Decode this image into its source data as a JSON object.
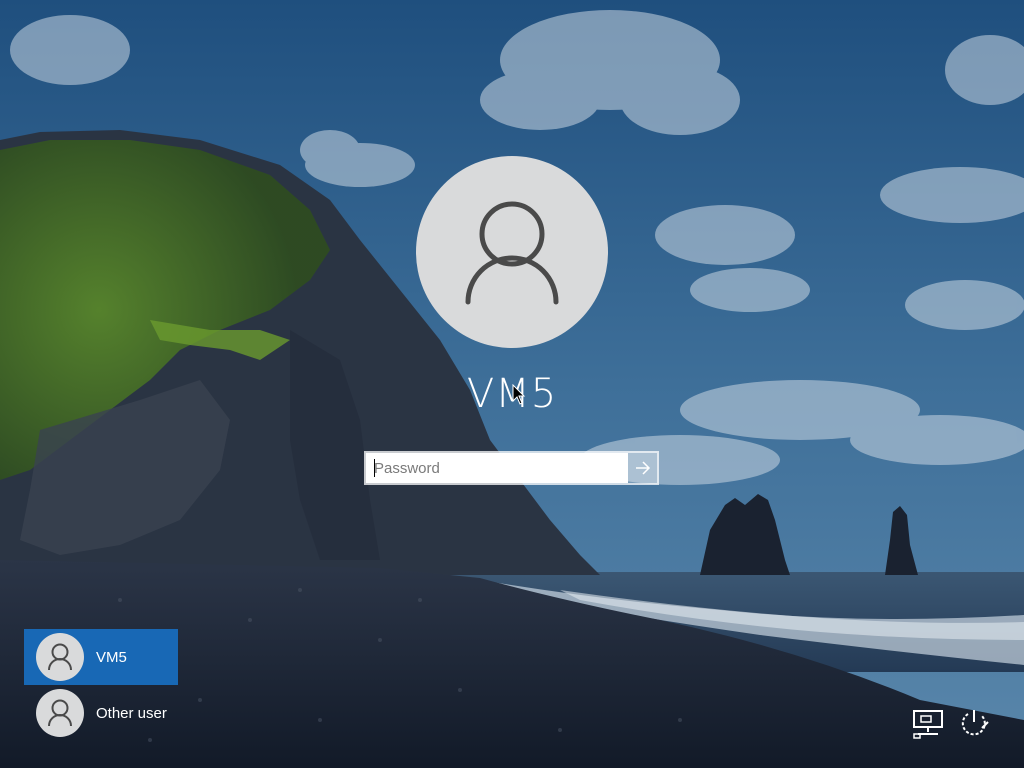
{
  "account": {
    "username": "VM5",
    "password_placeholder": "Password",
    "submit_icon": "arrow-right-icon"
  },
  "user_list": [
    {
      "label": "VM5",
      "icon": "user-icon",
      "selected": true
    },
    {
      "label": "Other user",
      "icon": "user-icon",
      "selected": false
    }
  ],
  "corner_controls": {
    "network_icon": "network-icon",
    "power_icon": "power-icon"
  },
  "colors": {
    "selected_tile": "#1868b5",
    "avatar_bg": "#d9dadb",
    "avatar_glyph": "#4a4a4a"
  }
}
